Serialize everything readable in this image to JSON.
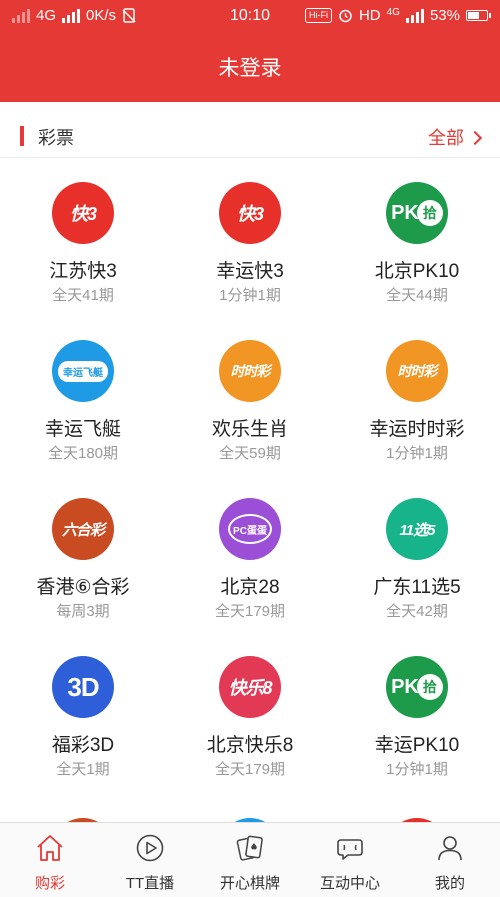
{
  "status_bar": {
    "network": "4G",
    "speed": "0K/s",
    "time": "10:10",
    "hifi": "Hi-Fi",
    "hd": "HD",
    "net2": "4G",
    "battery": "53%"
  },
  "header": {
    "title": "未登录"
  },
  "section": {
    "label": "彩票",
    "more_label": "全部"
  },
  "lotteries": [
    {
      "name": "江苏快3",
      "sub": "全天41期",
      "icon": "kuai3-red-icon",
      "logo_text": "快3"
    },
    {
      "name": "幸运快3",
      "sub": "1分钟1期",
      "icon": "kuai3-red-icon",
      "logo_text": "快3"
    },
    {
      "name": "北京PK10",
      "sub": "全天44期",
      "icon": "pk10-green-icon",
      "logo_text": "PK",
      "logo_text2": "拾"
    },
    {
      "name": "幸运飞艇",
      "sub": "全天180期",
      "icon": "feiting-blue-icon",
      "logo_text": "幸运飞艇"
    },
    {
      "name": "欢乐生肖",
      "sub": "全天59期",
      "icon": "shishicai-orange-icon",
      "logo_text": "时时彩"
    },
    {
      "name": "幸运时时彩",
      "sub": "1分钟1期",
      "icon": "shishicai-orange-icon",
      "logo_text": "时时彩"
    },
    {
      "name": "香港⑥合彩",
      "sub": "每周3期",
      "icon": "liuhecai-brown-icon",
      "logo_text": "六合彩"
    },
    {
      "name": "北京28",
      "sub": "全天179期",
      "icon": "pcdandan-purple-icon",
      "logo_text": "PC蛋蛋"
    },
    {
      "name": "广东11选5",
      "sub": "全天42期",
      "icon": "11xuan5-teal-icon",
      "logo_text": "11选5"
    },
    {
      "name": "福彩3D",
      "sub": "全天1期",
      "icon": "fucai3d-blue-icon",
      "logo_text": "3D"
    },
    {
      "name": "北京快乐8",
      "sub": "全天179期",
      "icon": "kuaile8-pink-icon",
      "logo_text": "快乐8"
    },
    {
      "name": "幸运PK10",
      "sub": "1分钟1期",
      "icon": "pk10-green-icon",
      "logo_text": "PK",
      "logo_text2": "拾"
    }
  ],
  "tabs": [
    {
      "label": "购彩",
      "icon": "home-icon",
      "active": true
    },
    {
      "label": "TT直播",
      "icon": "play-icon",
      "active": false
    },
    {
      "label": "开心棋牌",
      "icon": "cards-icon",
      "active": false
    },
    {
      "label": "互动中心",
      "icon": "chat-icon",
      "active": false
    },
    {
      "label": "我的",
      "icon": "user-icon",
      "active": false
    }
  ],
  "colors": {
    "brand": "#e53935",
    "tab_active": "#e53935",
    "text_muted": "#999999"
  }
}
